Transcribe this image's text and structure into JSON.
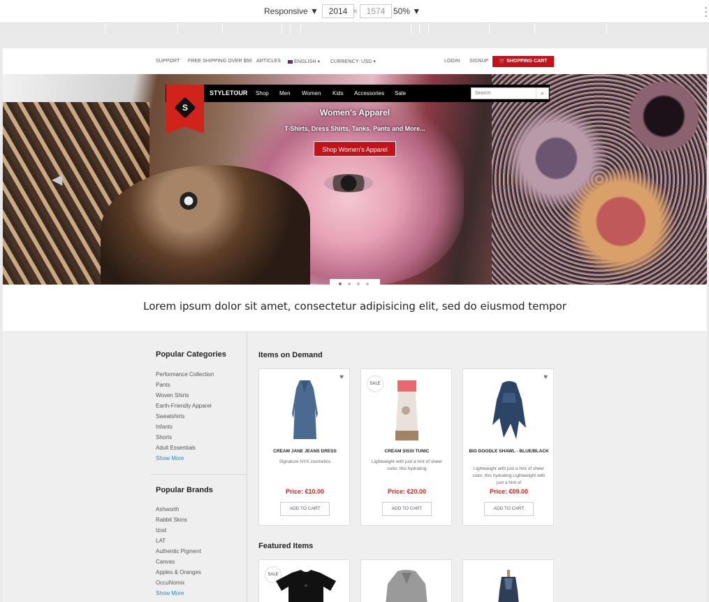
{
  "devtools": {
    "device": "Responsive",
    "width": "2014",
    "height": "1574",
    "zoom": "50%"
  },
  "topbar": {
    "support": "SUPPORT",
    "shipping": "FREE SHIPPING OVER $50",
    "articles": "ARTICLES",
    "language": "ENGLISH",
    "currency": "CURRENCY: USD",
    "login": "LOGIN",
    "signup": "SIGNUP",
    "cart": "SHOPPING CART"
  },
  "nav": {
    "logo_letter": "S",
    "brand": "STYLETOUR",
    "links": [
      "Shop",
      "Men",
      "Women",
      "Kids",
      "Accessories",
      "Sale"
    ],
    "search_placeholder": "Search"
  },
  "hero": {
    "title": "Women's Apparel",
    "subtitle": "T-Shirts, Dress Shirts, Tanks, Pants and More...",
    "button": "Shop Women's Apparel"
  },
  "tagline": "Lorem ipsum dolor sit amet, consectetur adipisicing elit, sed do eiusmod tempor",
  "sidebar": {
    "categories_title": "Popular Categories",
    "categories": [
      "Performance Collection",
      "Pants",
      "Woven Shirts",
      "Earth-Friendly Apparel",
      "Sweatshirts",
      "Infants",
      "Shorts",
      "Adult Essentials"
    ],
    "categories_more": "Show More",
    "brands_title": "Popular Brands",
    "brands": [
      "Ashworth",
      "Rabbit Skins",
      "Izod",
      "LAT",
      "Authentic Pigment",
      "Canvas",
      "Apples & Oranges",
      "OccuNomix"
    ],
    "brands_more": "Show More"
  },
  "demand": {
    "title": "Items on Demand",
    "items": [
      {
        "name": "CREAM JANE JEANS DRESS",
        "desc": "Signature NYX cosmetics",
        "price": "Price: €10.00",
        "cta": "ADD TO CART"
      },
      {
        "badge": "SALE",
        "name": "CREAM SISSI TUNIC",
        "desc": "Lightweight with just a hint of sheer color, this hydrating",
        "price": "Price: €20.00",
        "cta": "ADD TO CART"
      },
      {
        "name": "BIG DOODLE SHAWL - BLUE/BLACK",
        "desc": "Lightweight with just a hint of sheer color, this hydrating Lightweight with just a hint of",
        "price": "Price: €09.00",
        "cta": "ADD TO CART"
      }
    ]
  },
  "featured": {
    "title": "Featured Items",
    "items": [
      {
        "badge": "SALE"
      }
    ]
  }
}
